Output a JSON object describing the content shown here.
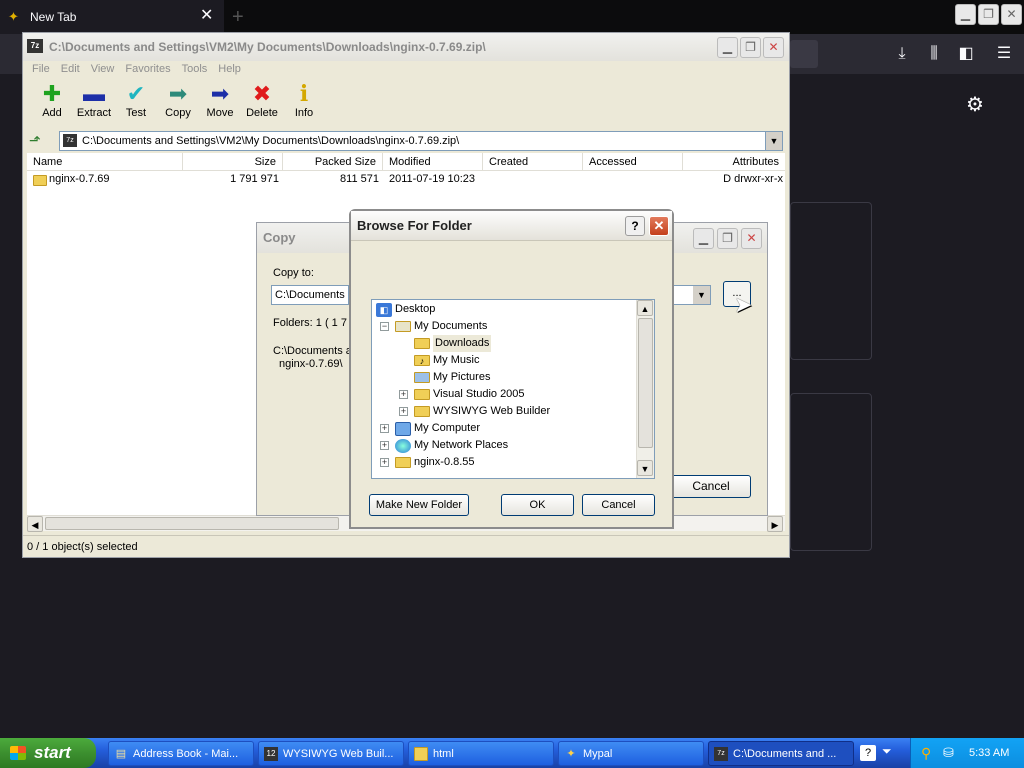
{
  "browser": {
    "tab_title": "New Tab",
    "tab_close": "✕",
    "new_tab_plus": "+",
    "toolbar_icons": [
      "download-icon",
      "library-icon",
      "sidebar-icon",
      "menu-icon"
    ],
    "settings_icon": "gear-icon"
  },
  "zip_window": {
    "title": "C:\\Documents and Settings\\VM2\\My Documents\\Downloads\\nginx-0.7.69.zip\\",
    "logo": "7z",
    "menu": [
      "File",
      "Edit",
      "View",
      "Favorites",
      "Tools",
      "Help"
    ],
    "toolbar": [
      {
        "label": "Add",
        "icon": "plus-icon",
        "glyph": "✚",
        "color": "#1fa31f"
      },
      {
        "label": "Extract",
        "icon": "minus-icon",
        "glyph": "▬",
        "color": "#1d2fa8"
      },
      {
        "label": "Test",
        "icon": "check-icon",
        "glyph": "✔",
        "color": "#1fb5c0"
      },
      {
        "label": "Copy",
        "icon": "copy-arrow-icon",
        "glyph": "➡",
        "color": "#2d8a7a"
      },
      {
        "label": "Move",
        "icon": "move-arrow-icon",
        "glyph": "➡",
        "color": "#1d2fa8"
      },
      {
        "label": "Delete",
        "icon": "delete-x-icon",
        "glyph": "✖",
        "color": "#e01b1b"
      },
      {
        "label": "Info",
        "icon": "info-icon",
        "glyph": "i",
        "color": "#d4a800"
      }
    ],
    "address": "C:\\Documents and Settings\\VM2\\My Documents\\Downloads\\nginx-0.7.69.zip\\",
    "columns": [
      "Name",
      "Size",
      "Packed Size",
      "Modified",
      "Created",
      "Accessed",
      "Attributes"
    ],
    "rows": [
      {
        "name": "nginx-0.7.69",
        "size": "1 791 971",
        "packed": "811 571",
        "modified": "2011-07-19 10:23",
        "created": "",
        "accessed": "",
        "attributes": "D drwxr-xr-x"
      }
    ],
    "status": "0 / 1 object(s) selected"
  },
  "copy_dialog": {
    "title": "Copy",
    "copy_to_label": "Copy to:",
    "path_value": "C:\\Documents a",
    "browse_label": "...",
    "folders_text": "Folders: 1    ( 1 7",
    "dest_line1": "C:\\Documents a",
    "dest_line2": "nginx-0.7.69\\",
    "cancel": "Cancel"
  },
  "browse_dialog": {
    "title": "Browse For Folder",
    "help": "?",
    "tree": [
      {
        "label": "Desktop",
        "icon": "desktop-icon",
        "indent": 0,
        "expander": ""
      },
      {
        "label": "My Documents",
        "icon": "my-documents-icon",
        "indent": 1,
        "expander": "−"
      },
      {
        "label": "Downloads",
        "icon": "folder-icon",
        "indent": 2,
        "expander": "",
        "selected": true
      },
      {
        "label": "My Music",
        "icon": "music-folder-icon",
        "indent": 2,
        "expander": ""
      },
      {
        "label": "My Pictures",
        "icon": "pictures-folder-icon",
        "indent": 2,
        "expander": ""
      },
      {
        "label": "Visual Studio 2005",
        "icon": "folder-icon",
        "indent": 2,
        "expander": "+"
      },
      {
        "label": "WYSIWYG Web Builder",
        "icon": "folder-icon",
        "indent": 2,
        "expander": "+"
      },
      {
        "label": "My Computer",
        "icon": "computer-icon",
        "indent": 1,
        "expander": "+"
      },
      {
        "label": "My Network Places",
        "icon": "network-icon",
        "indent": 1,
        "expander": "+"
      },
      {
        "label": "nginx-0.8.55",
        "icon": "folder-icon",
        "indent": 1,
        "expander": "+"
      }
    ],
    "make_new_folder": "Make New Folder",
    "ok": "OK",
    "cancel": "Cancel"
  },
  "taskbar": {
    "start": "start",
    "tasks": [
      {
        "label": "Address Book - Mai...",
        "icon": "address-book-icon"
      },
      {
        "label": "WYSIWYG Web Buil...",
        "icon": "web-builder-icon"
      },
      {
        "label": "html",
        "icon": "folder-icon"
      },
      {
        "label": "Mypal",
        "icon": "mypal-icon"
      },
      {
        "label": "C:\\Documents and ...",
        "icon": "7zip-icon",
        "active": true
      }
    ],
    "clock": "5:33 AM"
  }
}
